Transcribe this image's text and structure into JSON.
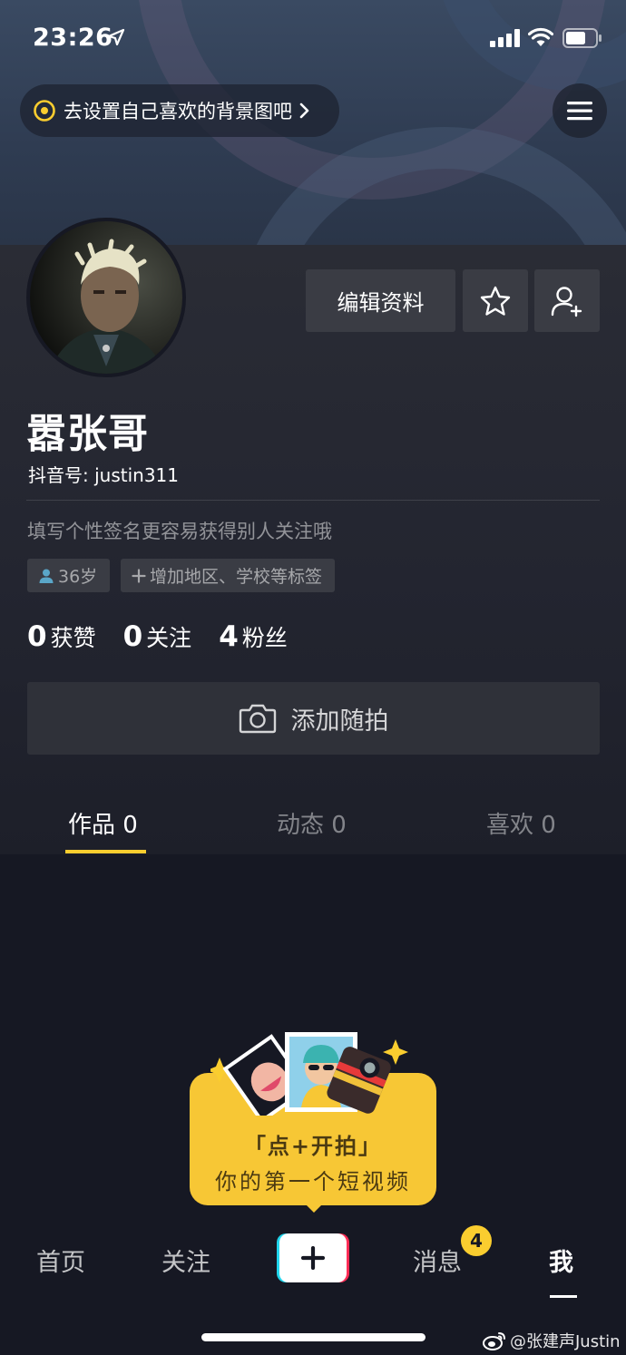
{
  "status_bar": {
    "time": "23:26",
    "icons": [
      "location-arrow-icon",
      "signal-icon",
      "wifi-icon",
      "battery-icon"
    ]
  },
  "header": {
    "bg_hint": "去设置自己喜欢的背景图吧",
    "menu_icon": "hamburger-menu-icon"
  },
  "profile": {
    "edit_button": "编辑资料",
    "favorite_icon": "star-icon",
    "add_friend_icon": "add-user-icon",
    "nickname": "嚣张哥",
    "douyin_id": "抖音号: justin311",
    "signature": "填写个性签名更容易获得别人关注哦",
    "tags": {
      "age": "36岁",
      "add": "增加地区、学校等标签"
    },
    "stats": [
      {
        "num": "0",
        "label": "获赞"
      },
      {
        "num": "0",
        "label": "关注"
      },
      {
        "num": "4",
        "label": "粉丝"
      }
    ],
    "snap_button": "添加随拍"
  },
  "tabs": [
    {
      "label": "作品 0",
      "active": true
    },
    {
      "label": "动态 0",
      "active": false
    },
    {
      "label": "喜欢 0",
      "active": false
    }
  ],
  "tooltip": {
    "line1": "「点+开拍」",
    "line2": "你的第一个短视频"
  },
  "bottom_nav": {
    "home": "首页",
    "follow": "关注",
    "publish_icon": "plus-icon",
    "messages": "消息",
    "message_badge": "4",
    "me": "我"
  },
  "watermark": "@张建声Justin",
  "colors": {
    "accent": "#facd2f",
    "background": "#161823",
    "tooltip": "#f7c735",
    "brand_cyan": "#20d5ec",
    "brand_pink": "#fe2c55"
  }
}
